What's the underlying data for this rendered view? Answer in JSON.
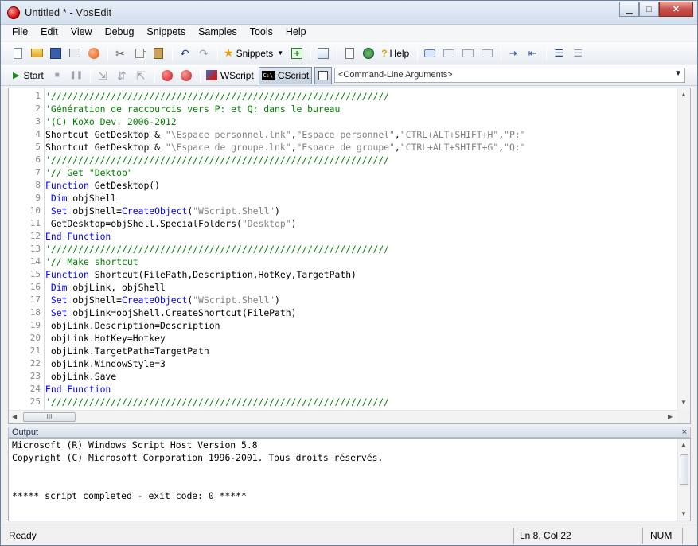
{
  "window": {
    "title": "Untitled * - VbsEdit",
    "minimize": "▁",
    "maximize": "□",
    "close": "✕"
  },
  "menu": [
    "File",
    "Edit",
    "View",
    "Debug",
    "Snippets",
    "Samples",
    "Tools",
    "Help"
  ],
  "toolbar1": {
    "snippets_label": "Snippets",
    "help_label": "Help"
  },
  "toolbar2": {
    "start_label": "Start",
    "wscript_label": "WScript",
    "cscript_label": "CScript",
    "cmdargs_placeholder": "<Command-Line Arguments>"
  },
  "editor": {
    "lines": [
      [
        [
          "cm",
          "'//////////////////////////////////////////////////////////////"
        ]
      ],
      [
        [
          "cm",
          "'Génération de raccourcis vers P: et Q: dans le bureau"
        ]
      ],
      [
        [
          "cm",
          "'(C) KoXo Dev. 2006-2012"
        ]
      ],
      [
        [
          "",
          "Shortcut GetDesktop & "
        ],
        [
          "st",
          "\"\\Espace personnel.lnk\""
        ],
        [
          "",
          ","
        ],
        [
          "st",
          "\"Espace personnel\""
        ],
        [
          "",
          ","
        ],
        [
          "st",
          "\"CTRL+ALT+SHIFT+H\""
        ],
        [
          "",
          ","
        ],
        [
          "st",
          "\"P:\""
        ]
      ],
      [
        [
          "",
          "Shortcut GetDesktop & "
        ],
        [
          "st",
          "\"\\Espace de groupe.lnk\""
        ],
        [
          "",
          ","
        ],
        [
          "st",
          "\"Espace de groupe\""
        ],
        [
          "",
          ","
        ],
        [
          "st",
          "\"CTRL+ALT+SHIFT+G\""
        ],
        [
          "",
          ","
        ],
        [
          "st",
          "\"Q:\""
        ]
      ],
      [
        [
          "cm",
          "'//////////////////////////////////////////////////////////////"
        ]
      ],
      [
        [
          "cm",
          "'// Get \"Dektop\""
        ]
      ],
      [
        [
          "kw",
          "Function"
        ],
        [
          "",
          " GetDesktop()"
        ]
      ],
      [
        [
          "",
          ""
        ],
        [
          "kw",
          " Dim"
        ],
        [
          "",
          " objShell"
        ]
      ],
      [
        [
          "",
          ""
        ],
        [
          "kw",
          " Set"
        ],
        [
          "",
          " objShell="
        ],
        [
          "bi",
          "CreateObject"
        ],
        [
          "",
          "("
        ],
        [
          "st",
          "\"WScript.Shell\""
        ],
        [
          "",
          ")"
        ]
      ],
      [
        [
          "",
          " GetDesktop=objShell.SpecialFolders("
        ],
        [
          "st",
          "\"Desktop\""
        ],
        [
          "",
          ")"
        ]
      ],
      [
        [
          "kw",
          "End Function"
        ]
      ],
      [
        [
          "cm",
          "'//////////////////////////////////////////////////////////////"
        ]
      ],
      [
        [
          "cm",
          "'// Make shortcut"
        ]
      ],
      [
        [
          "kw",
          "Function"
        ],
        [
          "",
          " Shortcut(FilePath,Description,HotKey,TargetPath)"
        ]
      ],
      [
        [
          "",
          ""
        ],
        [
          "kw",
          " Dim"
        ],
        [
          "",
          " objLink, objShell"
        ]
      ],
      [
        [
          "",
          ""
        ],
        [
          "kw",
          " Set"
        ],
        [
          "",
          " objShell="
        ],
        [
          "bi",
          "CreateObject"
        ],
        [
          "",
          "("
        ],
        [
          "st",
          "\"WScript.Shell\""
        ],
        [
          "",
          ")"
        ]
      ],
      [
        [
          "",
          ""
        ],
        [
          "kw",
          " Set"
        ],
        [
          "",
          " objLink=objShell.CreateShortcut(FilePath)"
        ]
      ],
      [
        [
          "",
          " objLink.Description=Description"
        ]
      ],
      [
        [
          "",
          " objLink.HotKey=Hotkey"
        ]
      ],
      [
        [
          "",
          " objLink.TargetPath=TargetPath"
        ]
      ],
      [
        [
          "",
          " objLink.WindowStyle=3"
        ]
      ],
      [
        [
          "",
          " objLink.Save"
        ]
      ],
      [
        [
          "kw",
          "End Function"
        ]
      ],
      [
        [
          "cm",
          "'//////////////////////////////////////////////////////////////"
        ]
      ]
    ]
  },
  "output": {
    "title": "Output",
    "close": "×",
    "lines": [
      "Microsoft (R) Windows Script Host Version 5.8",
      "Copyright (C) Microsoft Corporation 1996-2001. Tous droits réservés.",
      "",
      "",
      "***** script completed - exit code: 0 *****"
    ]
  },
  "status": {
    "ready": "Ready",
    "position": "Ln 8, Col 22",
    "num": "NUM"
  },
  "scroll": {
    "thumb_grip": "III"
  }
}
